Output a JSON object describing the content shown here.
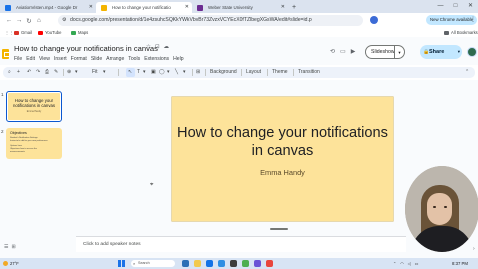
{
  "browser": {
    "tabs": [
      {
        "title": "AviationVisten.mp4 - Google Dr",
        "favicon_color": "#1a73e8",
        "active": false
      },
      {
        "title": "How to change your notificatio",
        "favicon_color": "#f4b400",
        "active": true
      },
      {
        "title": "Weber State University",
        "favicon_color": "#6b2c91",
        "active": false
      }
    ],
    "new_tab_label": "+",
    "window_controls": {
      "minimize": "—",
      "maximize": "□",
      "close": "✕"
    },
    "url": "docs.google.com/presentation/d/1e4zsuhcSQKkYWkVbvBr73ZvzxVCYEcX0fTZlbegXGsWA/edit#slide=id.p",
    "new_chrome_label": "New Chrome available",
    "bookmarks": [
      {
        "label": "Gmail",
        "color": "#d93025"
      },
      {
        "label": "YouTube",
        "color": "#ff0000"
      },
      {
        "label": "Maps",
        "color": "#34a853"
      }
    ],
    "all_bookmarks_label": "All Bookmarks"
  },
  "slides_app": {
    "doc_title": "How to change your notifications in canvas",
    "menu": [
      "File",
      "Edit",
      "View",
      "Insert",
      "Format",
      "Slide",
      "Arrange",
      "Tools",
      "Extensions",
      "Help"
    ],
    "slideshow_label": "Slideshow",
    "share_label": "Share",
    "toolbar": {
      "zoom_label": "Fit",
      "background_label": "Background",
      "layout_label": "Layout",
      "theme_label": "Theme",
      "transition_label": "Transition"
    },
    "thumbnails": [
      {
        "number": "1",
        "title": "How to change your notifications in canvas",
        "subtitle": "Emma Handy"
      },
      {
        "number": "2",
        "title": "Objectives",
        "lines": [
          "Student's Notification Settings",
          "Instructor's edit for your own preferences",
          "Options here",
          "Objectives how to access the announcements"
        ]
      }
    ],
    "slide": {
      "title": "How to change your notifications in canvas",
      "subtitle": "Emma Handy",
      "background": "#fde39a"
    },
    "notes_placeholder": "Click to add speaker notes"
  },
  "taskbar": {
    "weather": "27°F",
    "search_placeholder": "Search",
    "time": "8:37 PM"
  }
}
